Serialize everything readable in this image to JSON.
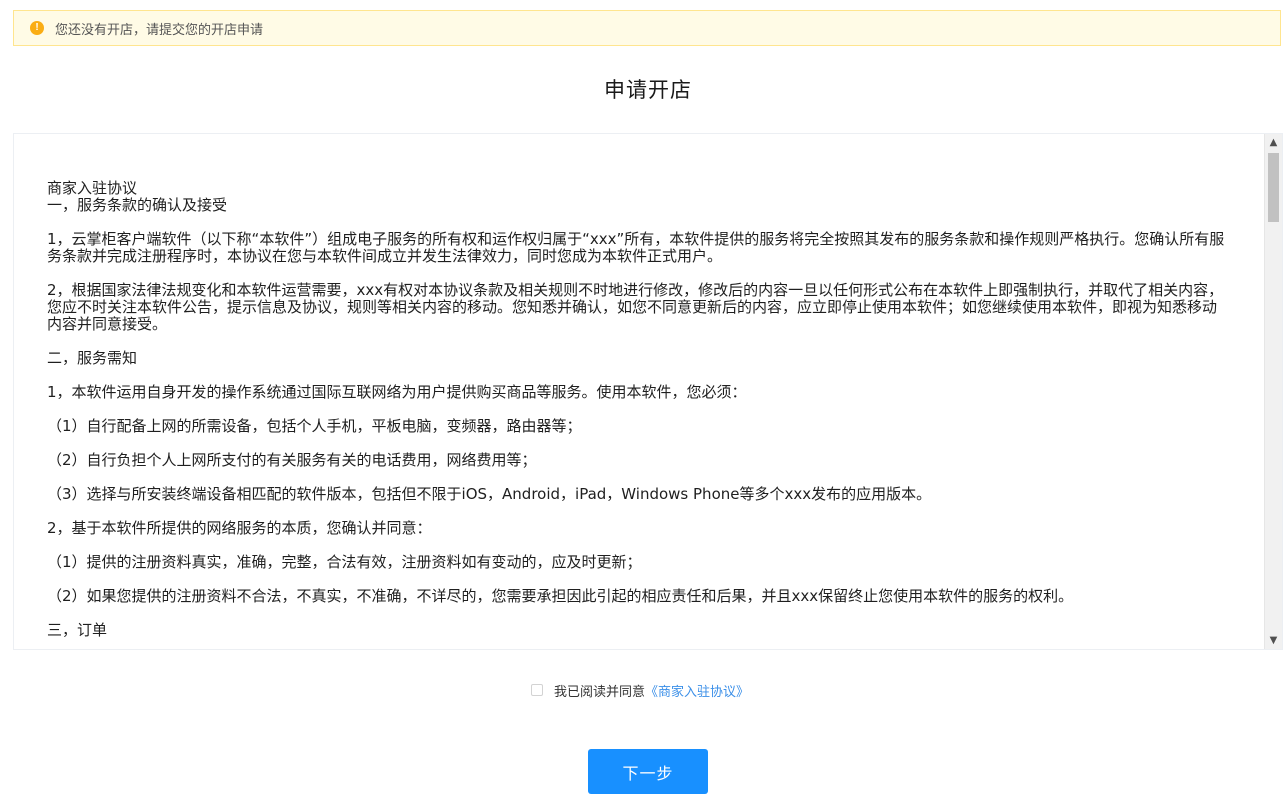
{
  "alert": {
    "icon": "exclamation-circle-icon",
    "icon_glyph": "!",
    "text": "您还没有开店，请提交您的开店申请",
    "color": "#faad14"
  },
  "page_title": "申请开店",
  "agreement": {
    "doc_title": "商家入驻协议",
    "paragraphs": [
      "一，服务条款的确认及接受",
      "1，云掌柜客户端软件（以下称“本软件”）组成电子服务的所有权和运作权归属于“xxx”所有，本软件提供的服务将完全按照其发布的服务条款和操作规则严格执行。您确认所有服务条款并完成注册程序时，本协议在您与本软件间成立并发生法律效力，同时您成为本软件正式用户。",
      "2，根据国家法律法规变化和本软件运营需要，xxx有权对本协议条款及相关规则不时地进行修改，修改后的内容一旦以任何形式公布在本软件上即强制执行，并取代了相关内容，您应不时关注本软件公告，提示信息及协议，规则等相关内容的移动。您知悉并确认，如您不同意更新后的内容，应立即停止使用本软件；如您继续使用本软件，即视为知悉移动内容并同意接受。",
      "二，服务需知",
      "1，本软件运用自身开发的操作系统通过国际互联网络为用户提供购买商品等服务。使用本软件，您必须：",
      "（1）自行配备上网的所需设备，包括个人手机，平板电脑，变频器，路由器等；",
      "（2）自行负担个人上网所支付的有关服务有关的电话费用，网络费用等；",
      "（3）选择与所安装终端设备相匹配的软件版本，包括但不限于iOS，Android，iPad，Windows Phone等多个xxx发布的应用版本。",
      "2，基于本软件所提供的网络服务的本质，您确认并同意：",
      "（1）提供的注册资料真实，准确，完整，合法有效，注册资料如有变动的，应及时更新；",
      "（2）如果您提供的注册资料不合法，不真实，不准确，不详尽的，您需要承担因此引起的相应责任和后果，并且xxx保留终止您使用本软件的服务的权利。",
      "三，订单"
    ]
  },
  "scrollbar": {
    "up_icon": "chevron-up-icon",
    "down_icon": "chevron-down-icon",
    "up_glyph": "▲",
    "down_glyph": "▼"
  },
  "agree": {
    "checked": false,
    "label": "我已阅读并同意",
    "link_text": "《商家入驻协议》",
    "link_color": "#3b8fe8"
  },
  "next_button": {
    "label": "下一步",
    "color": "#1890ff"
  }
}
